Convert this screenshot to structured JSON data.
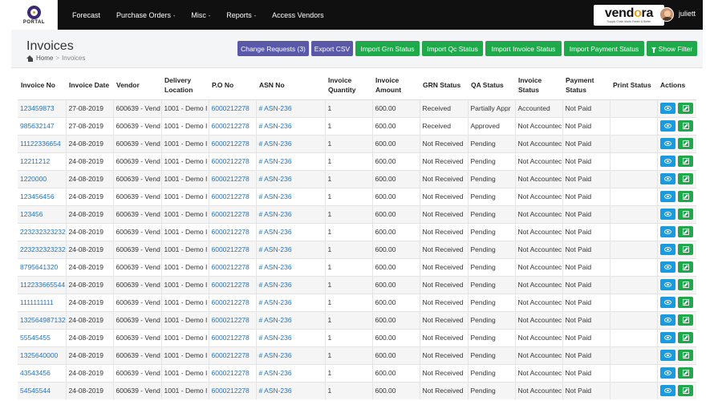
{
  "logo": {
    "text": "PORTAL"
  },
  "nav": {
    "items": [
      {
        "label": "Forecast",
        "dropdown": false
      },
      {
        "label": "Purchase Orders",
        "dropdown": true
      },
      {
        "label": "Misc",
        "dropdown": true
      },
      {
        "label": "Reports",
        "dropdown": true
      },
      {
        "label": "Access Vendors",
        "dropdown": false
      }
    ],
    "caret": "-"
  },
  "brand": {
    "text_a": "vend",
    "text_o": "o",
    "text_b": "ra",
    "tagline": "Supply Chain Made Faster & Better"
  },
  "user": {
    "name": "juliett"
  },
  "page": {
    "title": "Invoices",
    "breadcrumb": {
      "home": "Home",
      "sep": ">",
      "current": "Invoices"
    }
  },
  "buttons": {
    "change_requests": "Change Requests (3)",
    "export_csv": "Export CSV",
    "import_grn": "Import Grn Status",
    "import_qc": "Import Qc Status",
    "import_invoice": "Import Invoice Status",
    "import_payment": "Import Payment Status",
    "show_filter": "Show Filter"
  },
  "colors": {
    "accent_purple": "#5a58a8",
    "accent_green": "#1ea94a",
    "view_blue": "#1a9be0",
    "link": "#2a73b8"
  },
  "table": {
    "headers": [
      "Invoice No",
      "Invoice Date",
      "Vendor",
      "Delivery Location",
      "P.O No",
      "ASN No",
      "Invoice Quantity",
      "Invoice Amount",
      "GRN Status",
      "QA Status",
      "Invoice Status",
      "Payment Status",
      "Print Status",
      "Actions"
    ],
    "rows": [
      {
        "invoice_no": "123459873",
        "date": "27-08-2019",
        "vendor": "600639 - Vend",
        "location": "1001 - Demo I",
        "po": "6000212278",
        "asn": "# ASN-236",
        "qty": "1",
        "amount": "600.00",
        "grn": "Received",
        "qa": "Partially Appr",
        "inv_status": "Accounted",
        "pay_status": "Not Paid",
        "print": ""
      },
      {
        "invoice_no": "985632147",
        "date": "27-08-2019",
        "vendor": "600639 - Vend",
        "location": "1001 - Demo I",
        "po": "6000212278",
        "asn": "# ASN-236",
        "qty": "1",
        "amount": "600.00",
        "grn": "Received",
        "qa": "Approved",
        "inv_status": "Not Accountec",
        "pay_status": "Not Paid",
        "print": ""
      },
      {
        "invoice_no": "11122336654",
        "date": "24-08-2019",
        "vendor": "600639 - Vend",
        "location": "1001 - Demo I",
        "po": "6000212278",
        "asn": "# ASN-236",
        "qty": "1",
        "amount": "600.00",
        "grn": "Not Received",
        "qa": "Pending",
        "inv_status": "Not Accountec",
        "pay_status": "Not Paid",
        "print": ""
      },
      {
        "invoice_no": "12211212",
        "date": "24-08-2019",
        "vendor": "600639 - Vend",
        "location": "1001 - Demo I",
        "po": "6000212278",
        "asn": "# ASN-236",
        "qty": "1",
        "amount": "600.00",
        "grn": "Not Received",
        "qa": "Pending",
        "inv_status": "Not Accountec",
        "pay_status": "Not Paid",
        "print": ""
      },
      {
        "invoice_no": "1220000",
        "date": "24-08-2019",
        "vendor": "600639 - Vend",
        "location": "1001 - Demo I",
        "po": "6000212278",
        "asn": "# ASN-236",
        "qty": "1",
        "amount": "600.00",
        "grn": "Not Received",
        "qa": "Pending",
        "inv_status": "Not Accountec",
        "pay_status": "Not Paid",
        "print": ""
      },
      {
        "invoice_no": "123456456",
        "date": "24-08-2019",
        "vendor": "600639 - Vend",
        "location": "1001 - Demo I",
        "po": "6000212278",
        "asn": "# ASN-236",
        "qty": "1",
        "amount": "600.00",
        "grn": "Not Received",
        "qa": "Pending",
        "inv_status": "Not Accountec",
        "pay_status": "Not Paid",
        "print": ""
      },
      {
        "invoice_no": "123456",
        "date": "24-08-2019",
        "vendor": "600639 - Vend",
        "location": "1001 - Demo I",
        "po": "6000212278",
        "asn": "# ASN-236",
        "qty": "1",
        "amount": "600.00",
        "grn": "Not Received",
        "qa": "Pending",
        "inv_status": "Not Accountec",
        "pay_status": "Not Paid",
        "print": ""
      },
      {
        "invoice_no": "223232323232",
        "date": "24-08-2019",
        "vendor": "600639 - Vend",
        "location": "1001 - Demo I",
        "po": "6000212278",
        "asn": "# ASN-236",
        "qty": "1",
        "amount": "600.00",
        "grn": "Not Received",
        "qa": "Pending",
        "inv_status": "Not Accountec",
        "pay_status": "Not Paid",
        "print": ""
      },
      {
        "invoice_no": "223232323232",
        "date": "24-08-2019",
        "vendor": "600639 - Vend",
        "location": "1001 - Demo I",
        "po": "6000212278",
        "asn": "# ASN-236",
        "qty": "1",
        "amount": "600.00",
        "grn": "Not Received",
        "qa": "Pending",
        "inv_status": "Not Accountec",
        "pay_status": "Not Paid",
        "print": ""
      },
      {
        "invoice_no": "8795641320",
        "date": "24-08-2019",
        "vendor": "600639 - Vend",
        "location": "1001 - Demo I",
        "po": "6000212278",
        "asn": "# ASN-236",
        "qty": "1",
        "amount": "600.00",
        "grn": "Not Received",
        "qa": "Pending",
        "inv_status": "Not Accountec",
        "pay_status": "Not Paid",
        "print": ""
      },
      {
        "invoice_no": "112233665544",
        "date": "24-08-2019",
        "vendor": "600639 - Vend",
        "location": "1001 - Demo I",
        "po": "6000212278",
        "asn": "# ASN-236",
        "qty": "1",
        "amount": "600.00",
        "grn": "Not Received",
        "qa": "Pending",
        "inv_status": "Not Accountec",
        "pay_status": "Not Paid",
        "print": ""
      },
      {
        "invoice_no": "1111111111",
        "date": "24-08-2019",
        "vendor": "600639 - Vend",
        "location": "1001 - Demo I",
        "po": "6000212278",
        "asn": "# ASN-236",
        "qty": "1",
        "amount": "600.00",
        "grn": "Not Received",
        "qa": "Pending",
        "inv_status": "Not Accountec",
        "pay_status": "Not Paid",
        "print": ""
      },
      {
        "invoice_no": "132564987132",
        "date": "24-08-2019",
        "vendor": "600639 - Vend",
        "location": "1001 - Demo I",
        "po": "6000212278",
        "asn": "# ASN-236",
        "qty": "1",
        "amount": "600.00",
        "grn": "Not Received",
        "qa": "Pending",
        "inv_status": "Not Accountec",
        "pay_status": "Not Paid",
        "print": ""
      },
      {
        "invoice_no": "55545455",
        "date": "24-08-2019",
        "vendor": "600639 - Vend",
        "location": "1001 - Demo I",
        "po": "6000212278",
        "asn": "# ASN-236",
        "qty": "1",
        "amount": "600.00",
        "grn": "Not Received",
        "qa": "Pending",
        "inv_status": "Not Accountec",
        "pay_status": "Not Paid",
        "print": ""
      },
      {
        "invoice_no": "1325640000",
        "date": "24-08-2019",
        "vendor": "600639 - Vend",
        "location": "1001 - Demo I",
        "po": "6000212278",
        "asn": "# ASN-236",
        "qty": "1",
        "amount": "600.00",
        "grn": "Not Received",
        "qa": "Pending",
        "inv_status": "Not Accountec",
        "pay_status": "Not Paid",
        "print": ""
      },
      {
        "invoice_no": "43543456",
        "date": "24-08-2019",
        "vendor": "600639 - Vend",
        "location": "1001 - Demo I",
        "po": "6000212278",
        "asn": "# ASN-236",
        "qty": "1",
        "amount": "600.00",
        "grn": "Not Received",
        "qa": "Pending",
        "inv_status": "Not Accountec",
        "pay_status": "Not Paid",
        "print": ""
      },
      {
        "invoice_no": "54545544",
        "date": "24-08-2019",
        "vendor": "600639 - Vend",
        "location": "1001 - Demo I",
        "po": "6000212278",
        "asn": "# ASN-236",
        "qty": "1",
        "amount": "600.00",
        "grn": "Not Received",
        "qa": "Pending",
        "inv_status": "Not Accountec",
        "pay_status": "Not Paid",
        "print": ""
      }
    ]
  }
}
